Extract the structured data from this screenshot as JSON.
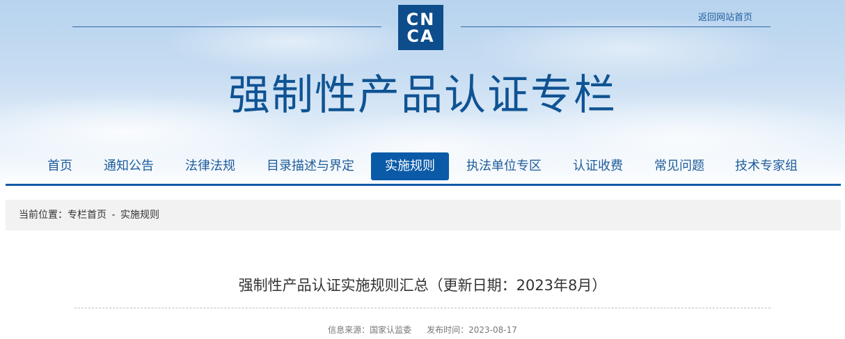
{
  "header": {
    "logo_lines": [
      "CN",
      "CA"
    ],
    "back_link": "返回网站首页",
    "site_title": "强制性产品认证专栏",
    "colors": {
      "brand": "#0e4d8c",
      "nav_active": "#0a5aa8",
      "title": "#0f5393"
    }
  },
  "nav": {
    "items": [
      {
        "label": "首页"
      },
      {
        "label": "通知公告"
      },
      {
        "label": "法律法规"
      },
      {
        "label": "目录描述与界定"
      },
      {
        "label": "实施规则",
        "active": true
      },
      {
        "label": "执法单位专区"
      },
      {
        "label": "认证收费"
      },
      {
        "label": "常见问题"
      },
      {
        "label": "技术专家组"
      }
    ]
  },
  "breadcrumb": {
    "prefix": "当前位置：",
    "home": "专栏首页",
    "separator": "-",
    "current": "实施规则"
  },
  "article": {
    "title": "强制性产品认证实施规则汇总（更新日期：2023年8月）",
    "source_label": "信息来源：国家认监委",
    "publish_label": "发布时间：2023-08-17"
  }
}
